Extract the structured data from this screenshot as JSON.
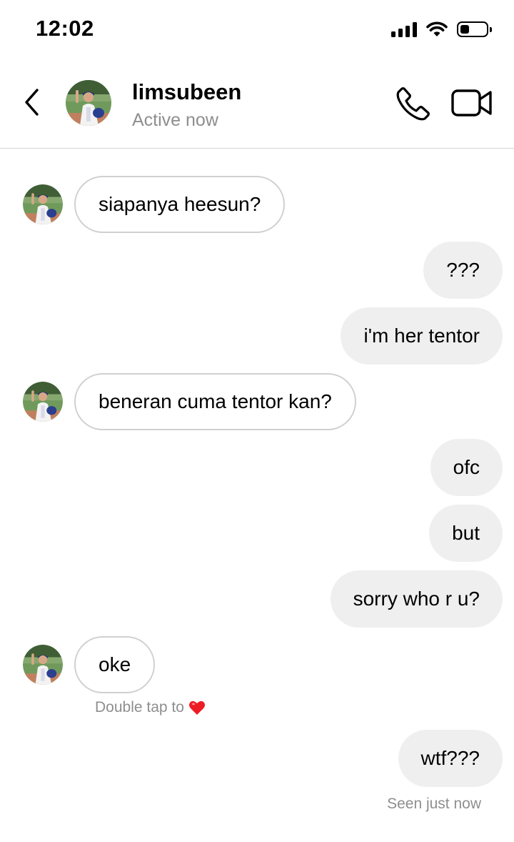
{
  "status_bar": {
    "time": "12:02",
    "signal_icon": "cellular-signal-icon",
    "wifi_icon": "wifi-icon",
    "battery_icon": "battery-icon",
    "battery_level": 0.35
  },
  "header": {
    "back_icon": "chevron-left-icon",
    "name": "limsubeen",
    "status": "Active now",
    "call_icon": "phone-icon",
    "video_icon": "video-camera-icon"
  },
  "messages": [
    {
      "side": "received",
      "text": "siapanya heesun?"
    },
    {
      "side": "sent",
      "text": "???"
    },
    {
      "side": "sent",
      "text": "i'm her tentor"
    },
    {
      "side": "received",
      "text": "beneran cuma tentor kan?"
    },
    {
      "side": "sent",
      "text": "ofc"
    },
    {
      "side": "sent",
      "text": "but"
    },
    {
      "side": "sent",
      "text": "sorry who r u?"
    },
    {
      "side": "received",
      "text": "oke"
    },
    {
      "side": "sent",
      "text": "wtf???"
    }
  ],
  "double_tap_hint": {
    "text": "Double tap to",
    "icon": "heart-icon"
  },
  "seen_text": "Seen just now",
  "colors": {
    "sent_bubble": "#efefef",
    "received_border": "#d0d0d0",
    "secondary_text": "#8e8e8e",
    "heart": "#ed1c24"
  }
}
